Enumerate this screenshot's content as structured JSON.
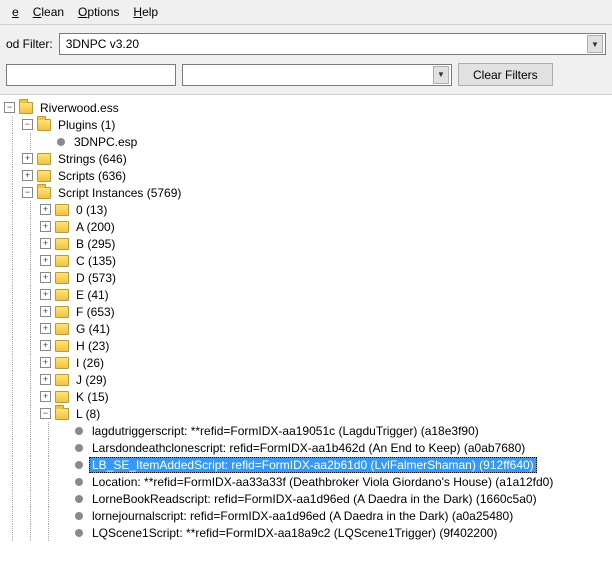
{
  "menu": {
    "file_suffix": "e",
    "clean": "Clean",
    "options": "Options",
    "help": "Help"
  },
  "filter": {
    "label": "od Filter:",
    "mod_value": "3DNPC v3.20",
    "clear_btn": "Clear Filters"
  },
  "tree": {
    "root": "Riverwood.ess",
    "plugins": "Plugins (1)",
    "plugin_1": "3DNPC.esp",
    "strings": "Strings (646)",
    "scripts": "Scripts (636)",
    "instances": "Script Instances (5769)",
    "groups": [
      "0 (13)",
      "A (200)",
      "B (295)",
      "C (135)",
      "D (573)",
      "E (41)",
      "F (653)",
      "G (41)",
      "H (23)",
      "I (26)",
      "J (29)",
      "K (15)",
      "L (8)"
    ],
    "l_items": [
      "lagdutriggerscript: **refid=FormIDX-aa19051c (LagduTrigger) (a18e3f90)",
      "Larsdondeathclonescript: refid=FormIDX-aa1b462d (An End to Keep) (a0ab7680)",
      "LB_SE_ItemAddedScript: refid=FormIDX-aa2b61d0 (LvlFalmerShaman) (912ff640)",
      "Location: **refid=FormIDX-aa33a33f (Deathbroker Viola Giordano's House) (a1a12fd0)",
      "LorneBookReadscript: refid=FormIDX-aa1d96ed (A Daedra in the Dark) (1660c5a0)",
      "lornejournalscript: refid=FormIDX-aa1d96ed (A Daedra in the Dark) (a0a25480)",
      "LQScene1Script: **refid=FormIDX-aa18a9c2 (LQScene1Trigger) (9f402200)"
    ],
    "selected_index": 2
  }
}
